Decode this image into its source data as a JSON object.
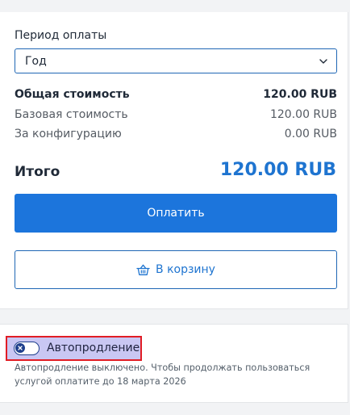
{
  "payment": {
    "period_label": "Период оплаты",
    "period_value": "Год",
    "rows": [
      {
        "label": "Общая стоимость",
        "value": "120.00 RUB"
      },
      {
        "label": "Базовая стоимость",
        "value": "120.00 RUB"
      },
      {
        "label": "За конфигурацию",
        "value": "0.00 RUB"
      }
    ],
    "total_label": "Итого",
    "total_value": "120.00 RUB",
    "pay_button": "Оплатить",
    "cart_button": "В корзину"
  },
  "autorenew": {
    "label": "Автопродление",
    "enabled": false,
    "note_line1": "Автопродление выключено. Чтобы продолжать пользоваться",
    "note_line2": "услугой оплатите до 18 марта 2026"
  },
  "colors": {
    "accent": "#1c75dc",
    "highlight_border": "#e11c24",
    "highlight_bg": "#c9c7f3"
  },
  "icons": {
    "select": "chevron-down-icon",
    "cart": "basket-icon",
    "toggle": "toggle-off-icon"
  }
}
